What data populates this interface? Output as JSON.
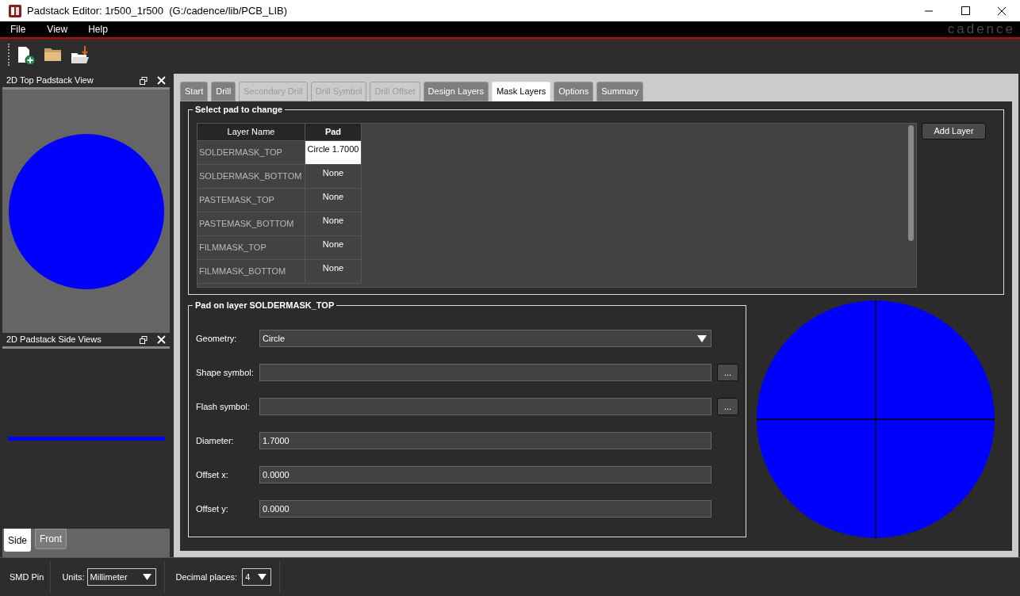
{
  "window": {
    "title": "Padstack Editor: 1r500_1r500  (G:/cadence/lib/PCB_LIB)"
  },
  "menu": [
    "File",
    "View",
    "Help"
  ],
  "brand": "cadence",
  "top_view": {
    "title": "2D Top Padstack View"
  },
  "side_views": {
    "title": "2D Padstack Side Views",
    "tabs": [
      {
        "label": "Side",
        "selected": true
      },
      {
        "label": "Front",
        "selected": false
      }
    ]
  },
  "tabs": [
    {
      "label": "Start",
      "selected": false,
      "disabled": false
    },
    {
      "label": "Drill",
      "selected": false,
      "disabled": false
    },
    {
      "label": "Secondary Drill",
      "selected": false,
      "disabled": true
    },
    {
      "label": "Drill Symbol",
      "selected": false,
      "disabled": true
    },
    {
      "label": "Drill Offset",
      "selected": false,
      "disabled": true
    },
    {
      "label": "Design Layers",
      "selected": false,
      "disabled": false
    },
    {
      "label": "Mask Layers",
      "selected": true,
      "disabled": false
    },
    {
      "label": "Options",
      "selected": false,
      "disabled": false
    },
    {
      "label": "Summary",
      "selected": false,
      "disabled": false
    }
  ],
  "select_pad": {
    "title": "Select pad to change",
    "columns": [
      "Layer Name",
      "Pad"
    ],
    "rows": [
      {
        "layer": "SOLDERMASK_TOP",
        "pad": "Circle 1.7000",
        "selected": true
      },
      {
        "layer": "SOLDERMASK_BOTTOM",
        "pad": "None",
        "selected": false
      },
      {
        "layer": "PASTEMASK_TOP",
        "pad": "None",
        "selected": false
      },
      {
        "layer": "PASTEMASK_BOTTOM",
        "pad": "None",
        "selected": false
      },
      {
        "layer": "FILMMASK_TOP",
        "pad": "None",
        "selected": false
      },
      {
        "layer": "FILMMASK_BOTTOM",
        "pad": "None",
        "selected": false
      }
    ],
    "add_button": "Add Layer"
  },
  "pad_on_layer": {
    "title": "Pad on layer SOLDERMASK_TOP",
    "fields": [
      {
        "label": "Geometry:",
        "kind": "select",
        "value": "Circle"
      },
      {
        "label": "Shape symbol:",
        "kind": "browse",
        "button": "..."
      },
      {
        "label": "Flash symbol:",
        "kind": "browse",
        "button": "..."
      },
      {
        "label": "Diameter:",
        "kind": "text",
        "value": "1.7000"
      },
      {
        "label": "Offset x:",
        "kind": "text",
        "value": "0.0000"
      },
      {
        "label": "Offset y:",
        "kind": "text",
        "value": "0.0000"
      }
    ]
  },
  "status_bar": {
    "pin_type": "SMD Pin",
    "units_label": "Units:",
    "units": "Millimeter",
    "decimal_label": "Decimal places:",
    "decimal": "4"
  }
}
